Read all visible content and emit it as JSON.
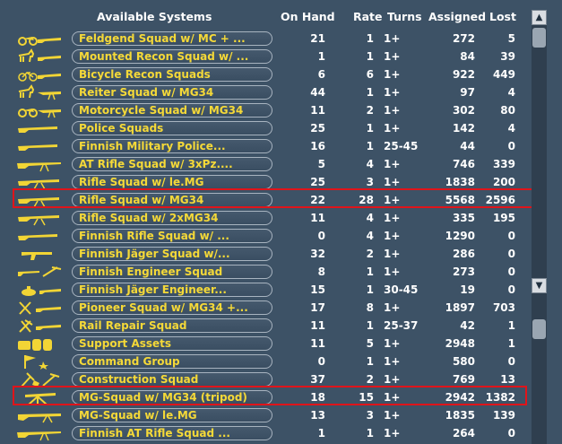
{
  "columns": {
    "available_systems": "Available Systems",
    "on_hand": "On Hand",
    "rate": "Rate",
    "turns": "Turns",
    "assigned": "Assigned",
    "lost": "Lost"
  },
  "rows": [
    {
      "name": "Feldgend Squad w/ MC + ...",
      "on_hand": "21",
      "rate": "1",
      "turns": "1+",
      "assigned": "272",
      "lost": "5",
      "icon": "motorcycle-rifle-icon"
    },
    {
      "name": "Mounted Recon Squad w/ ...",
      "on_hand": "1",
      "rate": "1",
      "turns": "1+",
      "assigned": "84",
      "lost": "39",
      "icon": "horse-rifle-icon"
    },
    {
      "name": "Bicycle Recon Squads",
      "on_hand": "6",
      "rate": "6",
      "turns": "1+",
      "assigned": "922",
      "lost": "449",
      "icon": "bicycle-rifle-icon"
    },
    {
      "name": "Reiter Squad w/ MG34",
      "on_hand": "44",
      "rate": "1",
      "turns": "1+",
      "assigned": "97",
      "lost": "4",
      "icon": "horse-mg-icon"
    },
    {
      "name": "Motorcycle Squad w/ MG34",
      "on_hand": "11",
      "rate": "2",
      "turns": "1+",
      "assigned": "302",
      "lost": "80",
      "icon": "motorcycle-mg-icon"
    },
    {
      "name": "Police Squads",
      "on_hand": "25",
      "rate": "1",
      "turns": "1+",
      "assigned": "142",
      "lost": "4",
      "icon": "rifle-icon"
    },
    {
      "name": "Finnish Military Police...",
      "on_hand": "16",
      "rate": "1",
      "turns": "25-45",
      "assigned": "44",
      "lost": "0",
      "icon": "rifle-icon"
    },
    {
      "name": "AT Rifle Squad w/ 3xPz....",
      "on_hand": "5",
      "rate": "4",
      "turns": "1+",
      "assigned": "746",
      "lost": "339",
      "icon": "at-rifle-icon"
    },
    {
      "name": "Rifle Squad w/ le.MG",
      "on_hand": "25",
      "rate": "3",
      "turns": "1+",
      "assigned": "1838",
      "lost": "200",
      "icon": "rifle-mg-icon"
    },
    {
      "name": "Rifle Squad w/ MG34",
      "on_hand": "22",
      "rate": "28",
      "turns": "1+",
      "assigned": "5568",
      "lost": "2596",
      "icon": "rifle-mg-icon"
    },
    {
      "name": "Rifle Squad w/ 2xMG34",
      "on_hand": "11",
      "rate": "4",
      "turns": "1+",
      "assigned": "335",
      "lost": "195",
      "icon": "rifle-mg-icon"
    },
    {
      "name": "Finnish Rifle Squad w/ ...",
      "on_hand": "0",
      "rate": "4",
      "turns": "1+",
      "assigned": "1290",
      "lost": "0",
      "icon": "rifle-icon"
    },
    {
      "name": "Finnish Jäger Squad w/...",
      "on_hand": "32",
      "rate": "2",
      "turns": "1+",
      "assigned": "286",
      "lost": "0",
      "icon": "smg-icon"
    },
    {
      "name": "Finnish Engineer Squad",
      "on_hand": "8",
      "rate": "1",
      "turns": "1+",
      "assigned": "273",
      "lost": "0",
      "icon": "engineer-icon"
    },
    {
      "name": "Finnish Jäger Engineer...",
      "on_hand": "15",
      "rate": "1",
      "turns": "30-45",
      "assigned": "19",
      "lost": "0",
      "icon": "mine-icon"
    },
    {
      "name": "Pioneer Squad w/ MG34 +...",
      "on_hand": "17",
      "rate": "8",
      "turns": "1+",
      "assigned": "1897",
      "lost": "703",
      "icon": "pioneer-icon"
    },
    {
      "name": "Rail Repair Squad",
      "on_hand": "11",
      "rate": "1",
      "turns": "25-37",
      "assigned": "42",
      "lost": "1",
      "icon": "tools-icon"
    },
    {
      "name": "Support Assets",
      "on_hand": "11",
      "rate": "5",
      "turns": "1+",
      "assigned": "2948",
      "lost": "1",
      "icon": "supply-barrels-icon"
    },
    {
      "name": "Command Group",
      "on_hand": "0",
      "rate": "1",
      "turns": "1+",
      "assigned": "580",
      "lost": "0",
      "icon": "command-flag-icon"
    },
    {
      "name": "Construction Squad",
      "on_hand": "37",
      "rate": "2",
      "turns": "1+",
      "assigned": "769",
      "lost": "13",
      "icon": "shovel-pick-icon"
    },
    {
      "name": "MG-Squad w/ MG34 (tripod)",
      "on_hand": "18",
      "rate": "15",
      "turns": "1+",
      "assigned": "2942",
      "lost": "1382",
      "icon": "mg-tripod-icon"
    },
    {
      "name": "MG-Squad w/ le.MG",
      "on_hand": "13",
      "rate": "3",
      "turns": "1+",
      "assigned": "1835",
      "lost": "139",
      "icon": "mg-icon"
    },
    {
      "name": "Finnish AT Rifle Squad ...",
      "on_hand": "1",
      "rate": "1",
      "turns": "1+",
      "assigned": "264",
      "lost": "0",
      "icon": "at-rifle-icon"
    }
  ],
  "highlighted": [
    "Rifle Squad w/ MG34",
    "MG-Squad w/ MG34 (tripod)"
  ],
  "colors": {
    "background": "#3d5266",
    "name_text": "#f5d938",
    "highlight": "#e0141a"
  }
}
